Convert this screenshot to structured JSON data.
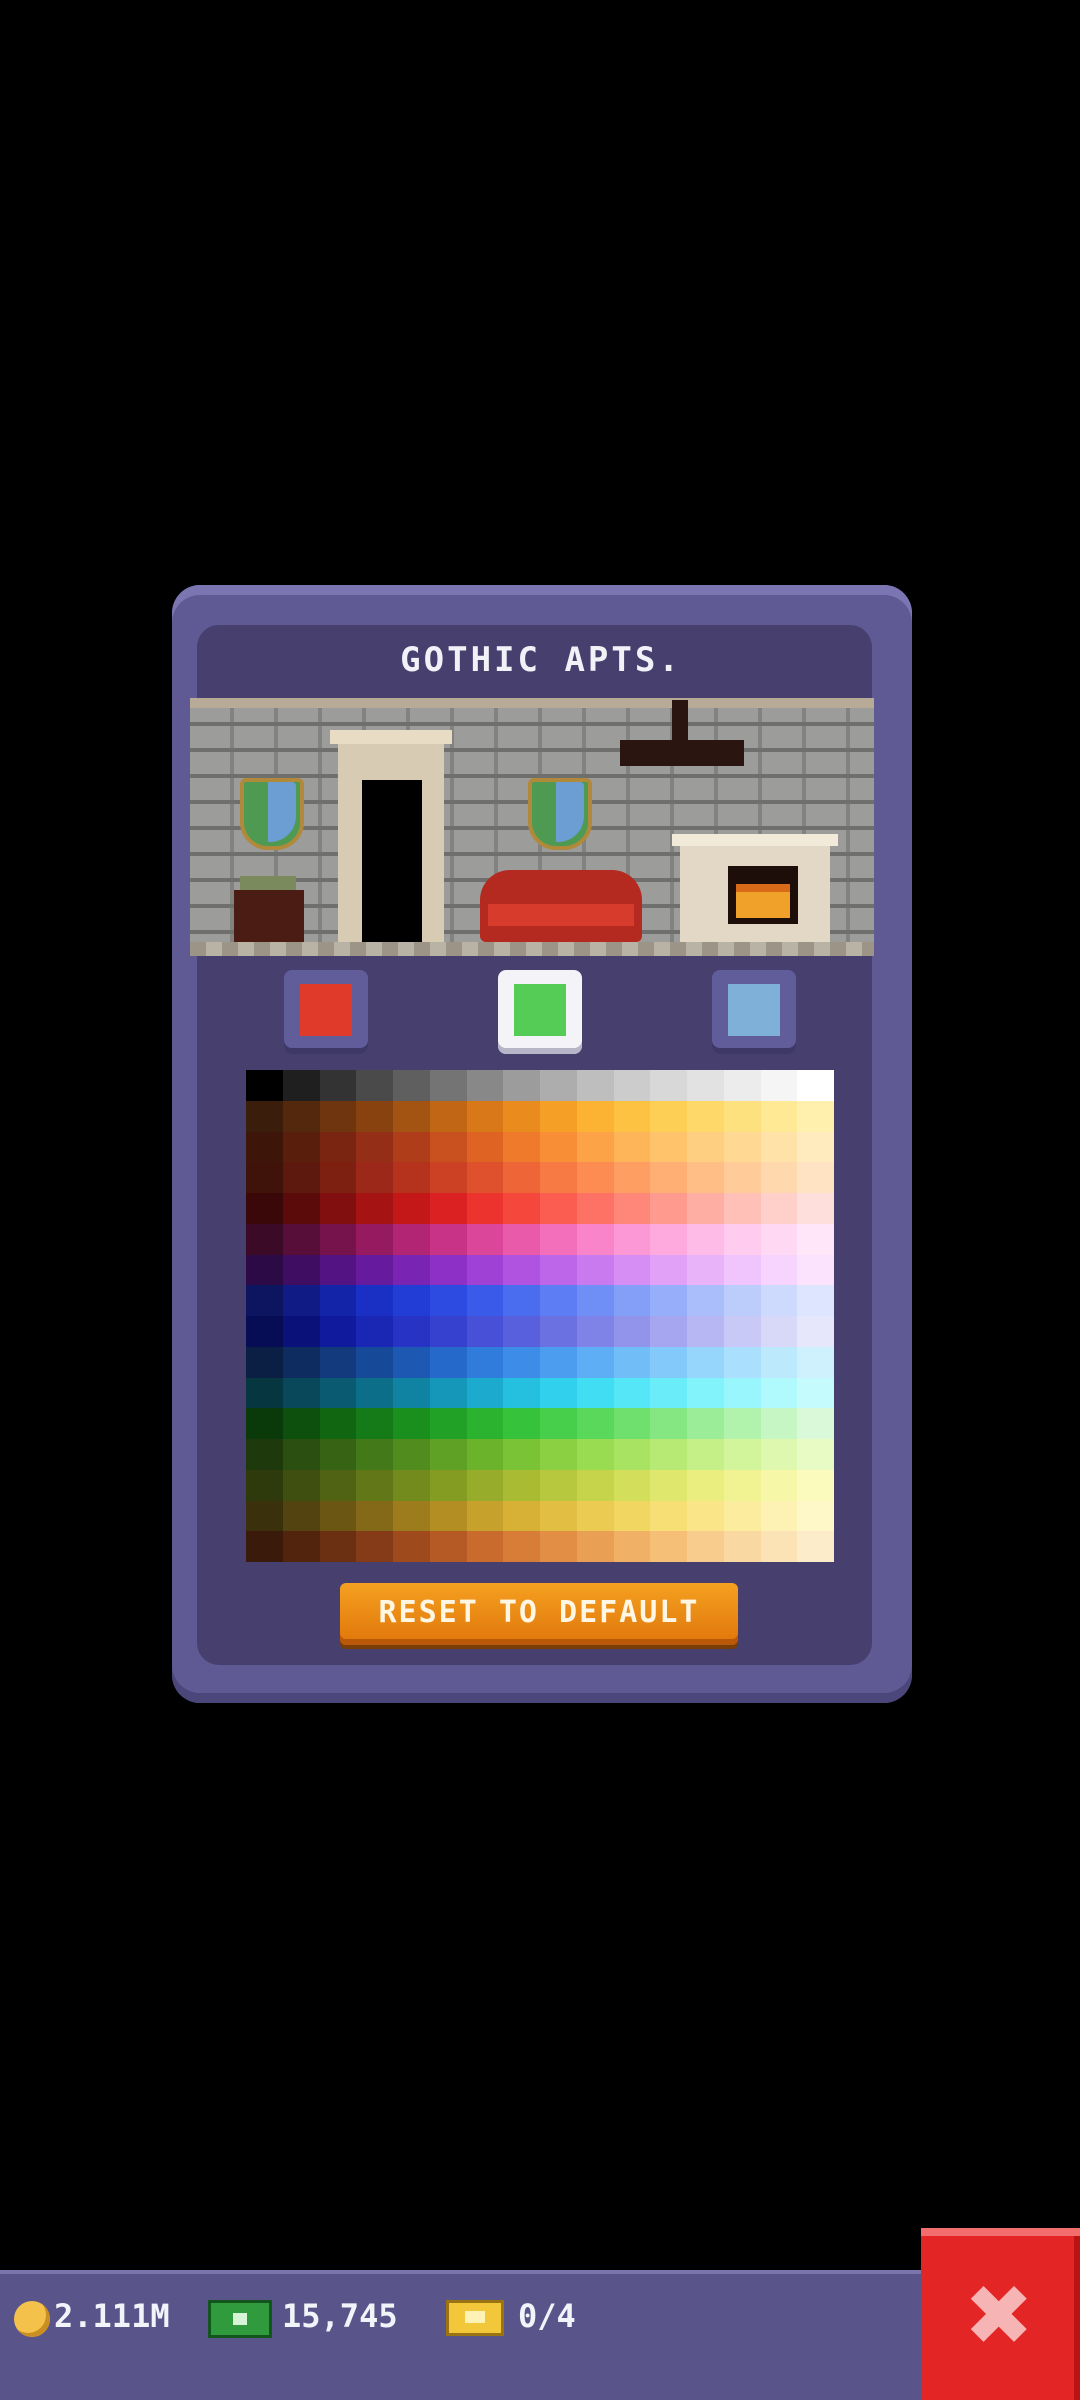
{
  "dialog": {
    "title": "GOTHIC APTS.",
    "reset_label": "RESET TO DEFAULT"
  },
  "swatches": [
    {
      "name": "color-slot-1",
      "color": "#e03a2a",
      "selected": false
    },
    {
      "name": "color-slot-2",
      "color": "#55cc55",
      "selected": true
    },
    {
      "name": "color-slot-3",
      "color": "#7fb1d8",
      "selected": false
    }
  ],
  "palette_rows": [
    [
      "#000000",
      "#1f1f1f",
      "#333333",
      "#4a4a4a",
      "#5f5f5f",
      "#747474",
      "#888888",
      "#9c9c9c",
      "#adadad",
      "#bebebe",
      "#cccccc",
      "#d8d8d8",
      "#e2e2e2",
      "#ececec",
      "#f5f5f5",
      "#ffffff"
    ],
    [
      "#3a1d0a",
      "#54280c",
      "#6e350e",
      "#874210",
      "#a35412",
      "#c06615",
      "#d97818",
      "#ea8b1d",
      "#f59f27",
      "#fcb232",
      "#fdc241",
      "#fecf55",
      "#fed96a",
      "#fee17f",
      "#ffe995",
      "#fff0ad"
    ],
    [
      "#3d1509",
      "#5a1e0d",
      "#7a2512",
      "#952e16",
      "#b03d1a",
      "#c9511f",
      "#df6424",
      "#ef7a2b",
      "#f88f37",
      "#fda347",
      "#feb458",
      "#fec36b",
      "#fecf80",
      "#ffd994",
      "#ffe2a8",
      "#ffebbd"
    ],
    [
      "#3f120a",
      "#5e190e",
      "#7d2012",
      "#9b2818",
      "#b5321d",
      "#cc4024",
      "#df512d",
      "#ee6537",
      "#f77944",
      "#fc8c52",
      "#fe9e62",
      "#ffaf74",
      "#ffbe86",
      "#ffcc99",
      "#ffd8ad",
      "#ffe3c2"
    ],
    [
      "#3a0808",
      "#5c0b0b",
      "#820f0f",
      "#a61313",
      "#c41818",
      "#db2121",
      "#ec332e",
      "#f6473d",
      "#fb5d50",
      "#fd7264",
      "#fe8779",
      "#ff9b8e",
      "#ffaea3",
      "#ffc0b7",
      "#ffd0ca",
      "#ffdfdb"
    ],
    [
      "#3a0a26",
      "#570e38",
      "#76134c",
      "#951a60",
      "#b22474",
      "#c83388",
      "#db469a",
      "#e95aab",
      "#f36fbb",
      "#f984c9",
      "#fc98d5",
      "#feaadf",
      "#ffbbe7",
      "#ffcbee",
      "#ffd9f3",
      "#ffe6f8"
    ],
    [
      "#2c0a45",
      "#3f0e63",
      "#531382",
      "#661a9d",
      "#7a24b4",
      "#8d31c6",
      "#9f41d5",
      "#af53e0",
      "#bd66e9",
      "#ca7aef",
      "#d68ef4",
      "#e0a1f7",
      "#e9b3fa",
      "#f0c4fc",
      "#f6d4fd",
      "#fbe3fe"
    ],
    [
      "#0d1460",
      "#101b85",
      "#1424a8",
      "#1a30c4",
      "#223dd6",
      "#2d4be1",
      "#3a5be9",
      "#4a6cef",
      "#5c7df3",
      "#6f8ef6",
      "#839ff8",
      "#97affa",
      "#aabefb",
      "#bccdfc",
      "#cddafd",
      "#dde6fe"
    ],
    [
      "#070d55",
      "#0a127a",
      "#101a9c",
      "#1a26b4",
      "#2733c4",
      "#3641cf",
      "#4750d7",
      "#5960dd",
      "#6c71e2",
      "#7f82e7",
      "#9294eb",
      "#a5a6ef",
      "#b7b8f3",
      "#c8c9f6",
      "#d8d9f9",
      "#e7e7fc"
    ],
    [
      "#0b1f45",
      "#0e2c60",
      "#123a7d",
      "#174999",
      "#1d59b3",
      "#256acb",
      "#307cdc",
      "#3d8de8",
      "#4c9df0",
      "#5daef5",
      "#70bdf8",
      "#83cafa",
      "#97d6fc",
      "#aae0fd",
      "#bde9fd",
      "#cff1fe"
    ],
    [
      "#063640",
      "#08485a",
      "#0a5b72",
      "#0d6e8a",
      "#1082a2",
      "#1597b9",
      "#1cabce",
      "#25bfe0",
      "#31d0ec",
      "#41ddf3",
      "#55e6f7",
      "#6bedf9",
      "#82f2fb",
      "#99f6fc",
      "#b0f9fd",
      "#c6fbfe"
    ],
    [
      "#0a3a0a",
      "#0d500e",
      "#116612",
      "#157b18",
      "#1a8f1e",
      "#21a226",
      "#2bb330",
      "#37c23c",
      "#47ce4a",
      "#5ad85b",
      "#6fe06e",
      "#85e782",
      "#9bed97",
      "#b1f2ad",
      "#c6f6c3",
      "#daf9d8"
    ],
    [
      "#1e3a0c",
      "#2a4f10",
      "#366414",
      "#437919",
      "#508d1e",
      "#5ea124",
      "#6cb32c",
      "#7bc336",
      "#8ad042",
      "#99db51",
      "#a8e362",
      "#b7ea74",
      "#c5f087",
      "#d2f49b",
      "#def8b0",
      "#e9fbc5"
    ],
    [
      "#2e3a0c",
      "#3f4f10",
      "#506314",
      "#617718",
      "#738a1d",
      "#859c23",
      "#97ac2a",
      "#a8bb33",
      "#b8c83e",
      "#c6d44b",
      "#d3de5b",
      "#dfe76c",
      "#e9ee7f",
      "#f1f393",
      "#f7f7a8",
      "#fbfbbd"
    ],
    [
      "#3a300c",
      "#524310",
      "#6b5614",
      "#846918",
      "#9c7c1d",
      "#b38f23",
      "#c6a12b",
      "#d6b135",
      "#e2bf42",
      "#ebcb51",
      "#f2d662",
      "#f7df75",
      "#fae689",
      "#fced9e",
      "#fdf2b3",
      "#fef7c8"
    ],
    [
      "#3a1a0a",
      "#52240e",
      "#6b2f12",
      "#853b17",
      "#9e4a1d",
      "#b55a24",
      "#c86b2d",
      "#d77d38",
      "#e28f45",
      "#eaa054",
      "#f0b065",
      "#f5bf78",
      "#f8cc8c",
      "#fad8a1",
      "#fce3b6",
      "#fdecca"
    ]
  ],
  "status": {
    "coins": "2.111M",
    "cash": "15,745",
    "tickets": "0/4"
  },
  "icons": {
    "coin": "coin-icon",
    "cash": "cash-icon",
    "ticket": "ticket-icon",
    "close": "close-icon"
  },
  "close_glyph": "✖"
}
